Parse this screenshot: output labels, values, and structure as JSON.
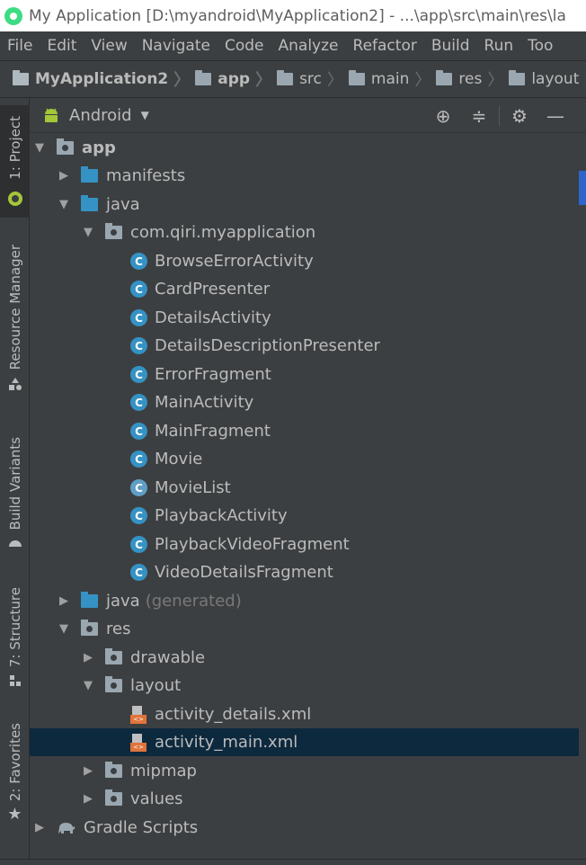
{
  "window": {
    "title": "My Application [D:\\myandroid\\MyApplication2] - ...\\app\\src\\main\\res\\la"
  },
  "menu": [
    "File",
    "Edit",
    "View",
    "Navigate",
    "Code",
    "Analyze",
    "Refactor",
    "Build",
    "Run",
    "Too"
  ],
  "breadcrumb": [
    "MyApplication2",
    "app",
    "src",
    "main",
    "res",
    "layout"
  ],
  "side_tabs": {
    "project": "1: Project",
    "resource_manager": "Resource Manager",
    "build_variants": "Build Variants",
    "structure": "7: Structure",
    "favorites": "2: Favorites"
  },
  "panel": {
    "view_mode": "Android"
  },
  "tree": {
    "app": "app",
    "manifests": "manifests",
    "java": "java",
    "package": "com.qiri.myapplication",
    "classes": [
      "BrowseErrorActivity",
      "CardPresenter",
      "DetailsActivity",
      "DetailsDescriptionPresenter",
      "ErrorFragment",
      "MainActivity",
      "MainFragment",
      "Movie",
      "MovieList",
      "PlaybackActivity",
      "PlaybackVideoFragment",
      "VideoDetailsFragment"
    ],
    "java_generated": "java",
    "generated_suffix": "(generated)",
    "res": "res",
    "drawable": "drawable",
    "layout": "layout",
    "layout_files": [
      "activity_details.xml",
      "activity_main.xml"
    ],
    "mipmap": "mipmap",
    "values": "values",
    "gradle": "Gradle Scripts"
  },
  "colors": {
    "background": "#3c3f41",
    "selection": "#0d293e",
    "class_icon": "#3592c4",
    "xml_icon": "#e0733a",
    "android_green": "#a4c639"
  }
}
